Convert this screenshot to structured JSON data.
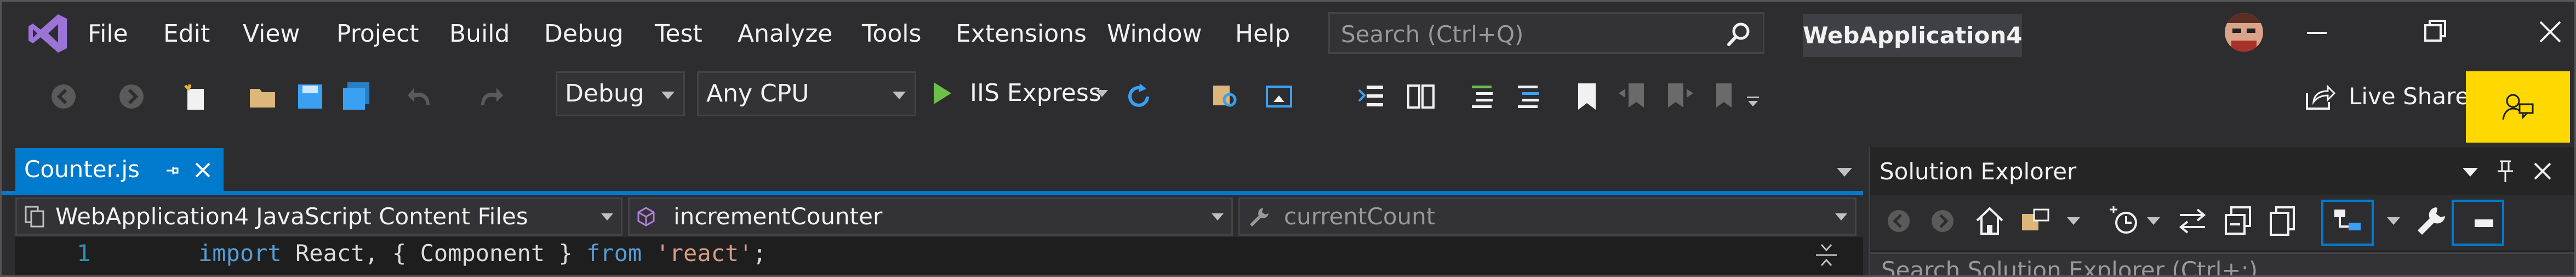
{
  "menu": [
    "File",
    "Edit",
    "View",
    "Project",
    "Build",
    "Debug",
    "Test",
    "Analyze",
    "Tools",
    "Extensions",
    "Window",
    "Help"
  ],
  "search": {
    "placeholder": "Search (Ctrl+Q)"
  },
  "solution_title": "WebApplication4",
  "toolbar": {
    "config": "Debug",
    "platform": "Any CPU",
    "run_label": "IIS Express",
    "live_share": "Live Share"
  },
  "editor": {
    "tab_label": "Counter.js",
    "nav_project": "WebApplication4 JavaScript Content Files",
    "nav_member": "incrementCounter",
    "nav_scope": "currentCount",
    "line_number": "1",
    "code": {
      "kw_import": "import",
      "ident": " React, { Component } ",
      "kw_from": "from",
      "sp": " ",
      "str": "'react'",
      "semi": ";"
    }
  },
  "solution_explorer": {
    "title": "Solution Explorer",
    "search_placeholder": "Search Solution Explorer (Ctrl+;)"
  },
  "colors": {
    "accent": "#007acc",
    "highlight": "#ffd800",
    "background": "#2d2d30"
  }
}
